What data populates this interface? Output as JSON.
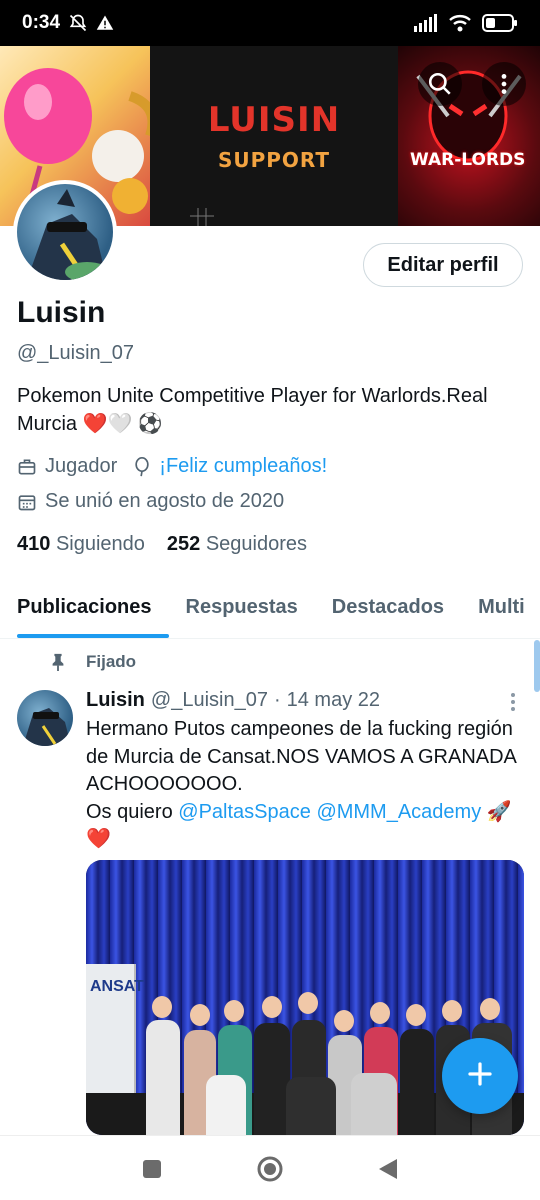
{
  "status_bar": {
    "time": "0:34",
    "battery_icon": "battery-icon",
    "wifi_icon": "wifi-icon",
    "signal_icon": "signal-icon"
  },
  "banner": {
    "title": "LUISIN",
    "subtitle": "SUPPORT",
    "team_logo_text": "WAR-LORDS"
  },
  "profile": {
    "edit_button": "Editar perfil",
    "display_name": "Luisin",
    "handle": "@_Luisin_07",
    "bio": "Pokemon Unite Competitive Player for Warlords.Real Murcia ❤️🤍 ⚽",
    "occupation": "Jugador",
    "birthday": "¡Feliz cumpleaños!",
    "joined": "Se unió en agosto de 2020",
    "following_count": "410",
    "following_label": "Siguiendo",
    "followers_count": "252",
    "followers_label": "Seguidores"
  },
  "tabs": [
    {
      "label": "Publicaciones",
      "active": true
    },
    {
      "label": "Respuestas",
      "active": false
    },
    {
      "label": "Destacados",
      "active": false
    },
    {
      "label": "Multi",
      "active": false
    }
  ],
  "tweet": {
    "pinned_label": "Fijado",
    "name": "Luisin",
    "handle": "@_Luisin_07",
    "separator": "·",
    "date": "14 may 22",
    "text_line1": "Hermano Putos campeones de la fucking región de Murcia de Cansat.NOS VAMOS A GRANADA ACHOOOOOOO.",
    "text_line2_prefix": "Os quiero ",
    "mention1": "@PaltasSpace",
    "mention2": "@MMM_Academy",
    "text_line2_suffix": " 🚀",
    "text_line3": "❤️",
    "media_banner_text": "ANSAT"
  },
  "colors": {
    "accent": "#1d9bf0",
    "text_primary": "#0f1419",
    "text_secondary": "#536471"
  }
}
